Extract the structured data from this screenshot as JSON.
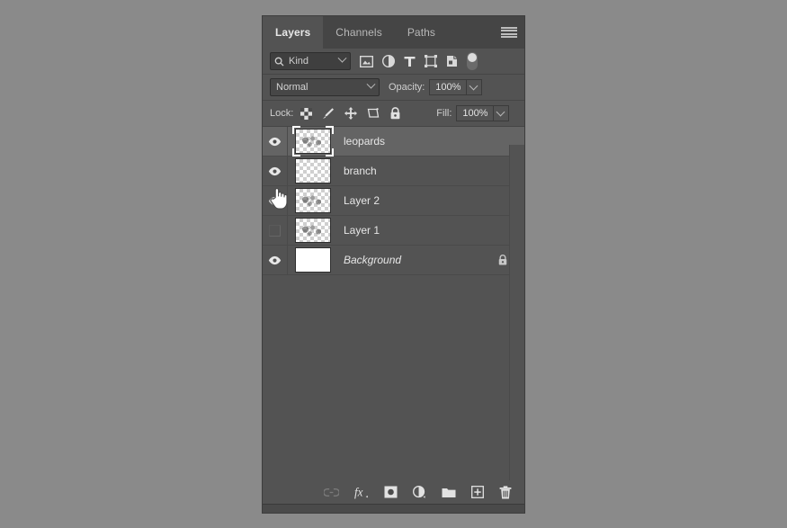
{
  "panel": {
    "tabs": [
      {
        "label": "Layers",
        "active": true
      },
      {
        "label": "Channels",
        "active": false
      },
      {
        "label": "Paths",
        "active": false
      }
    ],
    "menu_icon": "hamburger-menu-icon"
  },
  "filter": {
    "search_icon": "search-icon",
    "kind_label": "Kind",
    "icons": [
      "pixel-layer-filter-icon",
      "adjustment-layer-filter-icon",
      "type-layer-filter-icon",
      "shape-layer-filter-icon",
      "smart-object-filter-icon"
    ],
    "toggle_name": "filter-toggle-switch"
  },
  "blend": {
    "mode": "Normal",
    "opacity_label": "Opacity:",
    "opacity_value": "100%"
  },
  "lock": {
    "label": "Lock:",
    "icons": [
      "lock-transparent-pixels-icon",
      "lock-image-pixels-icon",
      "lock-position-icon",
      "lock-artboard-nesting-icon",
      "lock-all-icon"
    ],
    "fill_label": "Fill:",
    "fill_value": "100%"
  },
  "layers": [
    {
      "name": "leopards",
      "visible": true,
      "selected": true,
      "thumb": "transparent",
      "italic": false,
      "locked": false
    },
    {
      "name": "branch",
      "visible": true,
      "selected": false,
      "thumb": "transparent",
      "italic": false,
      "locked": false
    },
    {
      "name": "Layer 2",
      "visible": true,
      "selected": false,
      "thumb": "transparent",
      "italic": false,
      "locked": false
    },
    {
      "name": "Layer 1",
      "visible": false,
      "selected": false,
      "thumb": "transparent",
      "italic": false,
      "locked": false
    },
    {
      "name": "Background",
      "visible": true,
      "selected": false,
      "thumb": "solid",
      "italic": true,
      "locked": true
    }
  ],
  "bottom_toolbar": [
    "link-layers-icon",
    "layer-style-fx-icon",
    "add-layer-mask-icon",
    "new-adjustment-layer-icon",
    "new-group-icon",
    "new-layer-icon",
    "delete-layer-icon"
  ],
  "cursor": {
    "type": "pointing-hand-cursor"
  },
  "colors": {
    "panel_bg": "#535353",
    "tabbar_bg": "#454545",
    "selected_row": "#646464",
    "text": "#e6e6e6",
    "canvas_bg": "#8a8a8a"
  }
}
